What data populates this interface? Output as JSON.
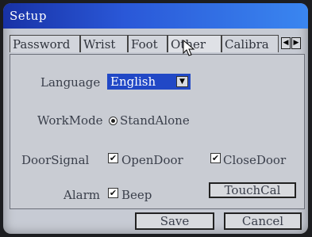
{
  "window": {
    "title": "Setup"
  },
  "tabs": [
    {
      "label": "Password"
    },
    {
      "label": "Wrist"
    },
    {
      "label": "Foot"
    },
    {
      "label": "Other"
    },
    {
      "label": "Calibra"
    }
  ],
  "tab_scroll": {
    "left_icon": "triangle-left-icon",
    "right_icon": "triangle-right-icon"
  },
  "form": {
    "language_label": "Language",
    "language_value": "English",
    "workmode_label": "WorkMode",
    "workmode_option": "StandAlone",
    "doorsignal_label": "DoorSignal",
    "opendoor_label": "OpenDoor",
    "opendoor_checked": true,
    "closedoor_label": "CloseDoor",
    "closedoor_checked": true,
    "alarm_label": "Alarm",
    "beep_label": "Beep",
    "beep_checked": true,
    "touchcal_label": "TouchCal"
  },
  "footer": {
    "save_label": "Save",
    "cancel_label": "Cancel"
  },
  "colors": {
    "titlebar_start": "#1832a6",
    "titlebar_end": "#3a86f0",
    "select_bg": "#2148c6"
  }
}
